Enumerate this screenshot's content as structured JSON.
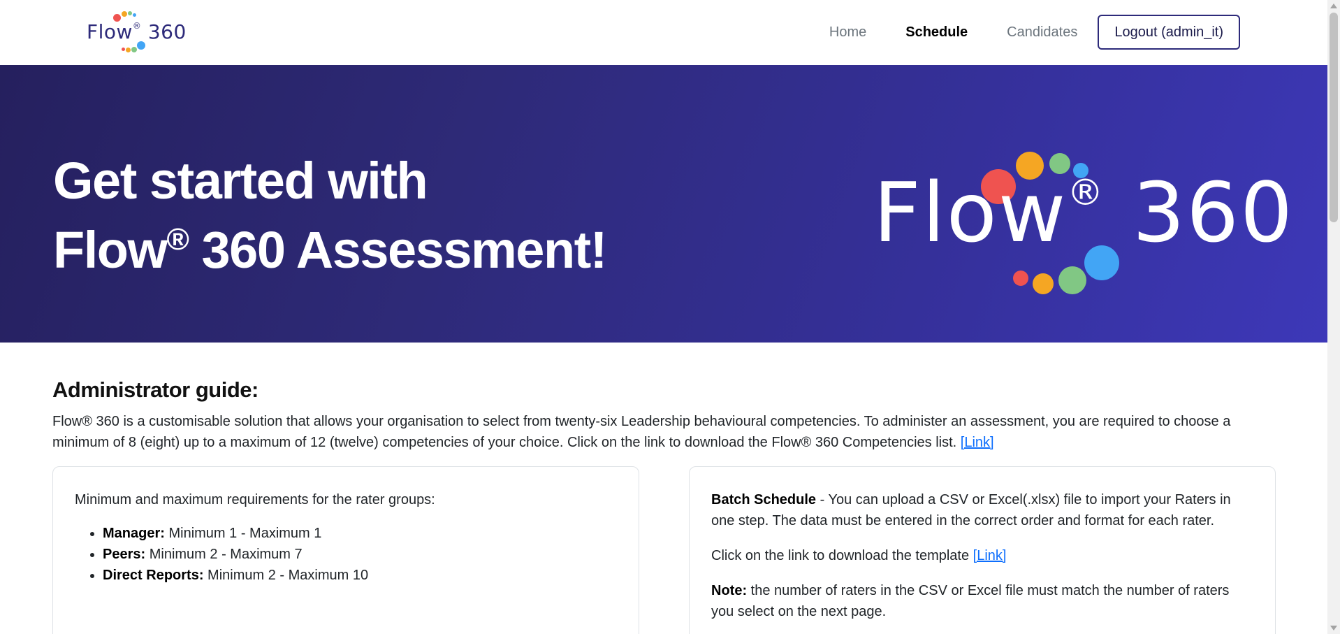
{
  "navbar": {
    "brand": {
      "name": "Flow",
      "reg": "®",
      "suffix": "360"
    },
    "links": [
      {
        "label": "Home",
        "active": false
      },
      {
        "label": "Schedule",
        "active": true
      },
      {
        "label": "Candidates",
        "active": false
      }
    ],
    "logout_label": "Logout (admin_it)"
  },
  "hero": {
    "title_line1": "Get started with",
    "title_line2_pre": "Flow",
    "title_line2_reg": "®",
    "title_line2_post": " 360 Assessment!",
    "logo": {
      "name": "Flow",
      "reg": "®",
      "suffix": "360"
    }
  },
  "guide": {
    "title": "Administrator guide:",
    "paragraph": "Flow® 360 is a customisable solution that allows your organisation to select from twenty-six Leadership behavioural competencies. To administer an assessment, you are required to choose a minimum of 8 (eight) up to a maximum of 12 (twelve) competencies of your choice. Click on the link to download the Flow® 360 Competencies list.",
    "link_label": "[Link]"
  },
  "rater_card": {
    "intro": "Minimum and maximum requirements for the rater groups:",
    "items": [
      {
        "label": "Manager:",
        "value": "Minimum 1 - Maximum 1"
      },
      {
        "label": "Peers:",
        "value": "Minimum 2 - Maximum 7"
      },
      {
        "label": "Direct Reports:",
        "value": "Minimum 2 - Maximum 10"
      }
    ]
  },
  "batch_card": {
    "title": "Batch Schedule",
    "text": " - You can upload a CSV or Excel(.xlsx) file to import your Raters in one step. The data must be entered in the correct order and format for each rater.",
    "template_text": "Click on the link to download the template",
    "template_link": "[Link]",
    "note_label": "Note:",
    "note_text": " the number of raters in the CSV or Excel file must match the number of raters you select on the next page."
  },
  "colors": {
    "brand_navy": "#2d2a7a",
    "hero_start": "#25205e",
    "hero_end": "#3d38b8",
    "dot_red": "#ef5350",
    "dot_orange": "#f5a623",
    "dot_green": "#81c784",
    "dot_blue": "#42a5f5",
    "link": "#0d6efd"
  }
}
